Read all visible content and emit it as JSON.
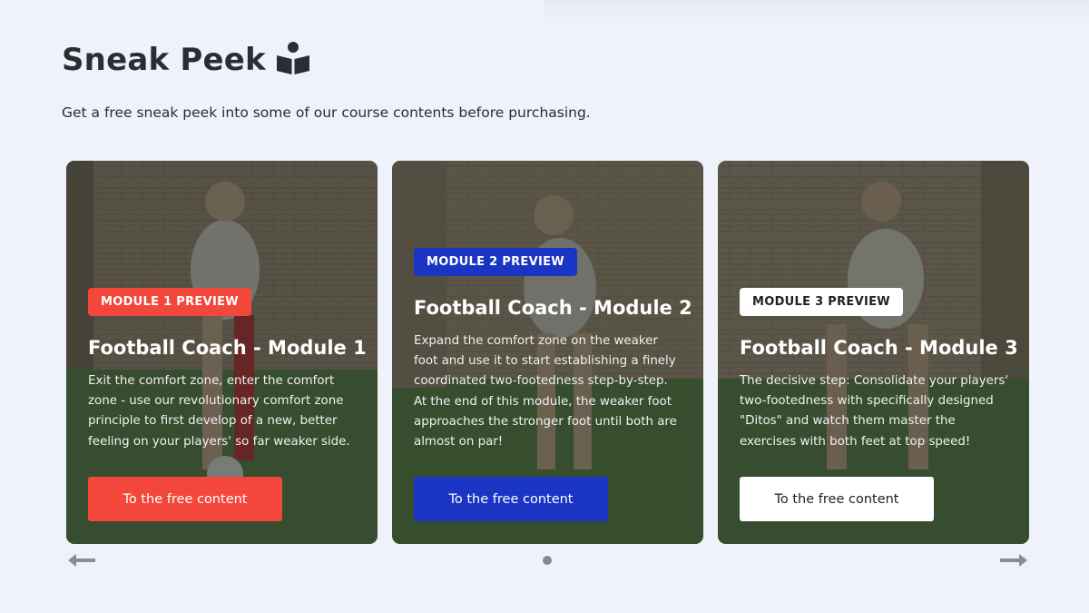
{
  "header": {
    "title": "Sneak Peek",
    "title_icon": "book-reader-icon",
    "subtitle": "Get a free sneak peek into some of our course contents before purchasing."
  },
  "cards": [
    {
      "badge": "MODULE 1 PREVIEW",
      "title": "Football Coach - Module 1",
      "description": "Exit the comfort zone, enter the comfort zone - use our revolutionary comfort zone principle to first develop of a new, better feeling on your players' so far weaker side.",
      "button": "To the free content",
      "accent": "#f2473a",
      "button_text_color": "#ffffff"
    },
    {
      "badge": "MODULE 2 PREVIEW",
      "title": "Football Coach - Module 2",
      "description": "Expand the comfort zone on the weaker foot and use it to start establishing a finely coordinated two-footedness step-by-step. At the end of this module, the weaker foot approaches the stronger foot until both are almost on par!",
      "button": "To the free content",
      "accent": "#1a35c4",
      "button_text_color": "#ffffff"
    },
    {
      "badge": "MODULE 3 PREVIEW",
      "title": "Football Coach - Module 3",
      "description": "The decisive step: Consolidate your players' two-footedness with specifically designed \"Ditos\" and watch them master the exercises with both feet at top speed!",
      "button": "To the free content",
      "accent": "#ffffff",
      "button_text_color": "#222222"
    }
  ],
  "carousel": {
    "prev_icon": "arrow-left-icon",
    "next_icon": "arrow-right-icon",
    "pages": 1,
    "active_page": 1
  }
}
